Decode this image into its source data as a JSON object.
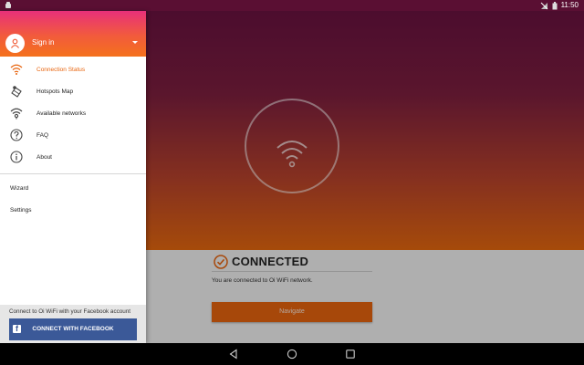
{
  "status_bar": {
    "time": "11:50"
  },
  "drawer": {
    "signin_label": "Sign in",
    "menu_items": [
      {
        "label": "Connection Status",
        "icon": "wifi-icon",
        "active": true
      },
      {
        "label": "Hotspots Map",
        "icon": "map-icon",
        "active": false
      },
      {
        "label": "Available networks",
        "icon": "wifi-signal-icon",
        "active": false
      },
      {
        "label": "FAQ",
        "icon": "help-icon",
        "active": false
      },
      {
        "label": "About",
        "icon": "info-icon",
        "active": false
      }
    ],
    "secondary_items": [
      {
        "label": "Wizard"
      },
      {
        "label": "Settings"
      }
    ],
    "facebook_caption": "Connect to Oi WiFi with your Facebook account",
    "facebook_button": "CONNECT WITH FACEBOOK"
  },
  "main": {
    "status_title": "CONNECTED",
    "status_description": "You are connected to Oi WiFi network.",
    "navigate_button": "Navigate"
  },
  "colors": {
    "accent": "#e8650f",
    "facebook": "#3b5998",
    "hero_top": "#6a1240",
    "hero_bottom": "#e6680f"
  }
}
